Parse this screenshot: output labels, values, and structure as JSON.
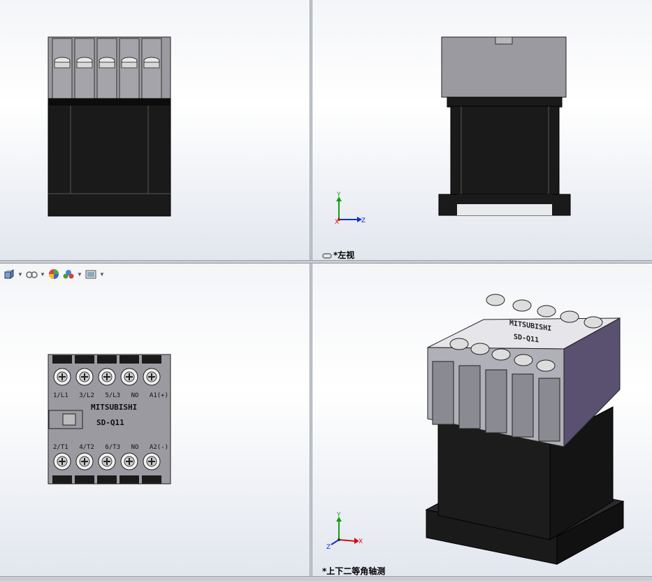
{
  "views": {
    "left_view": {
      "label": "*左视"
    },
    "isometric_view": {
      "label": "*上下二等角轴测"
    }
  },
  "triad": {
    "x": "X",
    "y": "Y",
    "z": "Z"
  },
  "product": {
    "brand": "MITSUBISHI",
    "model": "SD-Q11",
    "terminal_top_labels": [
      "1/L1",
      "3/L2",
      "5/L3",
      "NO",
      "A1(+)"
    ],
    "terminal_bottom_labels": [
      "2/T1",
      "4/T2",
      "6/T3",
      "NO",
      "A2(-)"
    ]
  },
  "toolbar": {
    "icons": [
      "view-orientation-icon",
      "hide-show-items-icon",
      "edit-appearance-icon",
      "apply-scene-icon",
      "view-settings-icon"
    ]
  },
  "colors": {
    "body_black": "#1a1a1a",
    "terminal_gray": "#9a9aa0",
    "iso_side_purple": "#5a5070",
    "axis_x": "#d01010",
    "axis_y": "#10a010",
    "axis_z": "#1030d0"
  }
}
